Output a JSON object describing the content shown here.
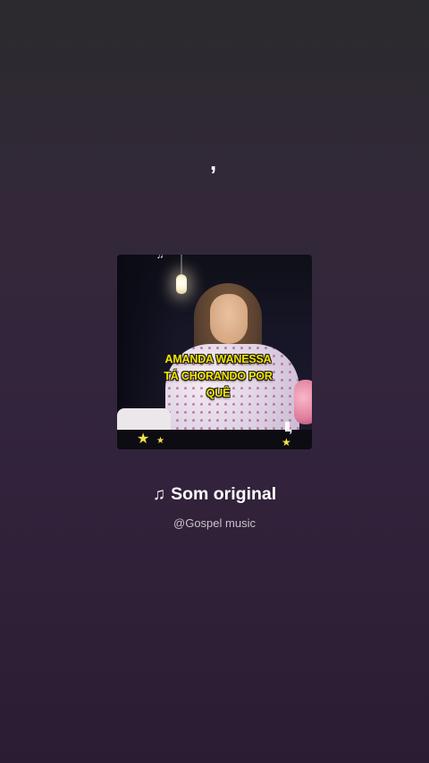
{
  "artwork": {
    "caption_lines": [
      "AMANDA WANESSA",
      "TÁ CHORANDO POR",
      "QUÊ"
    ],
    "pause_glyph": "II,",
    "overlay_glyph": "♫",
    "stars": [
      "★",
      "★",
      "★"
    ]
  },
  "mark_top": ",",
  "audio": {
    "note_icon": "♫",
    "title": "Som original",
    "author": "@Gospel music"
  },
  "colors": {
    "caption_yellow": "#f2e400",
    "title_text": "#ffffff",
    "subtitle_text": "#c9c3cc",
    "background_top": "#2f2b31",
    "background_bottom": "#2b1c33"
  }
}
